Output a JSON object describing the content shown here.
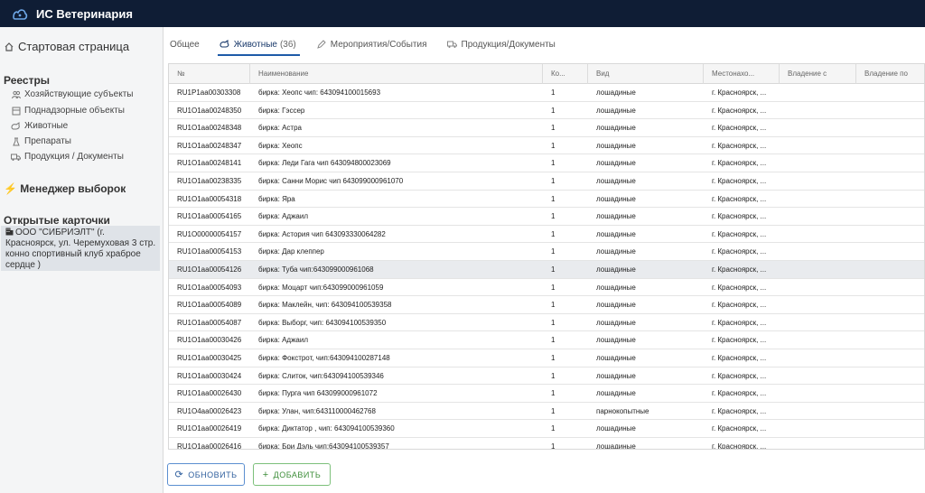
{
  "app": {
    "title": "ИС Ветеринария"
  },
  "sidebar": {
    "home": "Стартовая страница",
    "registries_title": "Реестры",
    "registries": [
      {
        "label": "Хозяйствующие субъекты",
        "icon": "people-icon"
      },
      {
        "label": "Поднадзорные объекты",
        "icon": "objects-icon"
      },
      {
        "label": "Животные",
        "icon": "animal-icon"
      },
      {
        "label": "Препараты",
        "icon": "medicine-icon"
      },
      {
        "label": "Продукция / Документы",
        "icon": "truck-icon"
      }
    ],
    "selection_manager": "Менеджер выборок",
    "open_cards_title": "Открытые карточки",
    "open_card": "ООО \"СИБРИЭЛТ\" (г. Красноярск, ул. Черемуховая 3 стр. конно спортивный клуб храброе сердце )"
  },
  "tabs": [
    {
      "label": "Общее",
      "count": ""
    },
    {
      "label": "Животные",
      "count": "(36)"
    },
    {
      "label": "Мероприятия/События",
      "count": ""
    },
    {
      "label": "Продукция/Документы",
      "count": ""
    }
  ],
  "table": {
    "headers": [
      "№",
      "Наименование",
      "Ко...",
      "Вид",
      "Местонахо...",
      "Владение с",
      "Владение по"
    ],
    "rows": [
      [
        "RU1P1aa00303308",
        "бирка: Хеопс чип: 643094100015693",
        "1",
        "лошадиные",
        "г. Красноярск, ..."
      ],
      [
        "RU1O1aa00248350",
        "бирка: Гэссер",
        "1",
        "лошадиные",
        "г. Красноярск, ..."
      ],
      [
        "RU1O1aa00248348",
        "бирка: Астра",
        "1",
        "лошадиные",
        "г. Красноярск, ..."
      ],
      [
        "RU1O1aa00248347",
        "бирка: Хеопс",
        "1",
        "лошадиные",
        "г. Красноярск, ..."
      ],
      [
        "RU1O1aa00248141",
        "бирка: Леди Гага чип 643094800023069",
        "1",
        "лошадиные",
        "г. Красноярск, ..."
      ],
      [
        "RU1O1aa00238335",
        "бирка: Санни Морис чип 643099000961070",
        "1",
        "лошадиные",
        "г. Красноярск, ..."
      ],
      [
        "RU1O1aa00054318",
        "бирка: Яра",
        "1",
        "лошадиные",
        "г. Красноярск, ..."
      ],
      [
        "RU1O1aa00054165",
        "бирка: Аджаил",
        "1",
        "лошадиные",
        "г. Красноярск, ..."
      ],
      [
        "RU1O00000054157",
        "бирка: Астория чип 643093330064282",
        "1",
        "лошадиные",
        "г. Красноярск, ..."
      ],
      [
        "RU1O1aa00054153",
        "бирка: Дар клеппер",
        "1",
        "лошадиные",
        "г. Красноярск, ..."
      ],
      [
        "RU1O1aa00054126",
        "бирка: Туба чип:643099000961068",
        "1",
        "лошадиные",
        "г. Красноярск, ..."
      ],
      [
        "RU1O1aa00054093",
        "бирка: Моцарт чип:643099000961059",
        "1",
        "лошадиные",
        "г. Красноярск, ..."
      ],
      [
        "RU1O1aa00054089",
        "бирка: Маклейн, чип: 643094100539358",
        "1",
        "лошадиные",
        "г. Красноярск, ..."
      ],
      [
        "RU1O1aa00054087",
        "бирка: Выборг, чип: 643094100539350",
        "1",
        "лошадиные",
        "г. Красноярск, ..."
      ],
      [
        "RU1O1aa00030426",
        "бирка: Аджаил",
        "1",
        "лошадиные",
        "г. Красноярск, ..."
      ],
      [
        "RU1O1aa00030425",
        "бирка: Фокстрот, чип:643094100287148",
        "1",
        "лошадиные",
        "г. Красноярск, ..."
      ],
      [
        "RU1O1aa00030424",
        "бирка: Слиток, чип:643094100539346",
        "1",
        "лошадиные",
        "г. Красноярск, ..."
      ],
      [
        "RU1O1aa00026430",
        "бирка: Пурга чип 643099000961072",
        "1",
        "лошадиные",
        "г. Красноярск, ..."
      ],
      [
        "RU1O4aa00026423",
        "бирка: Улан, чип:643110000462768",
        "1",
        "парнокопытные",
        "г. Красноярск, ..."
      ],
      [
        "RU1O1aa00026419",
        "бирка: Диктатор , чип: 643094100539360",
        "1",
        "лошадиные",
        "г. Красноярск, ..."
      ],
      [
        "RU1O1aa00026416",
        "бирка: Бри Дэль чип:643094100539357",
        "1",
        "лошадиные",
        "г. Красноярск, ..."
      ]
    ]
  },
  "buttons": {
    "refresh": "ОБНОВИТЬ",
    "add": "ДОБАВИТЬ"
  },
  "colors": {
    "topbar": "#0f1d35",
    "accent": "#1e5aa8",
    "add": "#3e8e3a"
  }
}
